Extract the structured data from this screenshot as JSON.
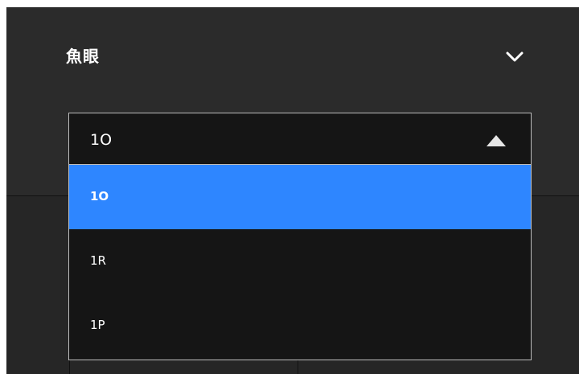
{
  "section": {
    "title": "魚眼",
    "collapse_icon": "chevron-down-icon"
  },
  "dropdown": {
    "selected_value": "1O",
    "caret_icon": "caret-up-icon",
    "options": [
      {
        "label": "1O",
        "selected": true
      },
      {
        "label": "1R",
        "selected": false
      },
      {
        "label": "1P",
        "selected": false
      }
    ]
  },
  "colors": {
    "panel_bg": "#2b2b2b",
    "dropdown_bg": "#151515",
    "selected_bg": "#2e86ff",
    "border": "#bdbdbd",
    "text": "#ffffff"
  }
}
